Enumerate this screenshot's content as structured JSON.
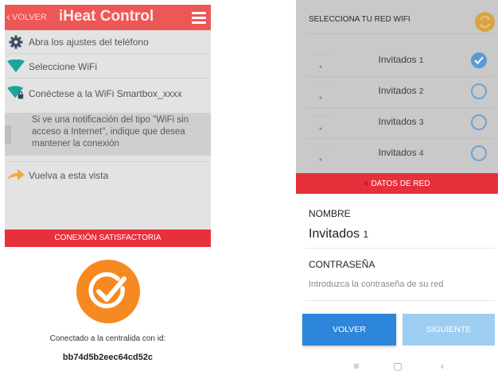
{
  "left_screen": {
    "back_label": "VOLVER",
    "title": "iHeat Control",
    "steps": [
      {
        "icon": "gear-icon",
        "text": "Abra los ajustes del teléfono"
      },
      {
        "icon": "wifi-icon",
        "text": "Seleccione WiFi"
      },
      {
        "icon": "wifi-lock-icon",
        "text": "Conéctese a la WiFi Smartbox_xxxx"
      },
      {
        "icon": "arrow-right-icon",
        "text": "Vuelva a esta vista"
      }
    ],
    "notice": "Si ve una notificación del tipo \"WiFi sin acceso a Internet\", indique que desea mantener la conexión",
    "status_bar": "CONEXIÓN SATISFACTORIA",
    "connected_label": "Conectado a la centralida con id:",
    "device_id": "bb74d5b2eec64cd52c",
    "colors": {
      "header": "#ed5756",
      "status_bar": "#e8303c",
      "success": "#f6891f",
      "accent_icon": "#1aa598"
    }
  },
  "right_screen": {
    "header_label": "SELECCIONA TU RED WIFI",
    "networks": [
      {
        "name": "Invitados",
        "num": "1",
        "selected": true
      },
      {
        "name": "Invitados",
        "num": "2",
        "selected": false
      },
      {
        "name": "Invitados",
        "num": "3",
        "selected": false
      },
      {
        "name": "Invitados",
        "num": "4",
        "selected": false
      }
    ],
    "section_bar": "DATOS DE RED",
    "name_label": "NOMBRE",
    "name_value": "Invitados",
    "name_value_num": "1",
    "password_label": "CONTRASEÑA",
    "password_placeholder": "Introduzca la contraseña de su red",
    "password_value": "",
    "back_button": "VOLVER",
    "next_button": "SIGUIENTE",
    "system_nav": [
      "≡",
      "▢",
      "‹"
    ],
    "colors": {
      "radio": "#5b9ad3",
      "refresh": "#d7a540",
      "back_button": "#2d86d9",
      "next_button": "#9ecdf2"
    }
  }
}
